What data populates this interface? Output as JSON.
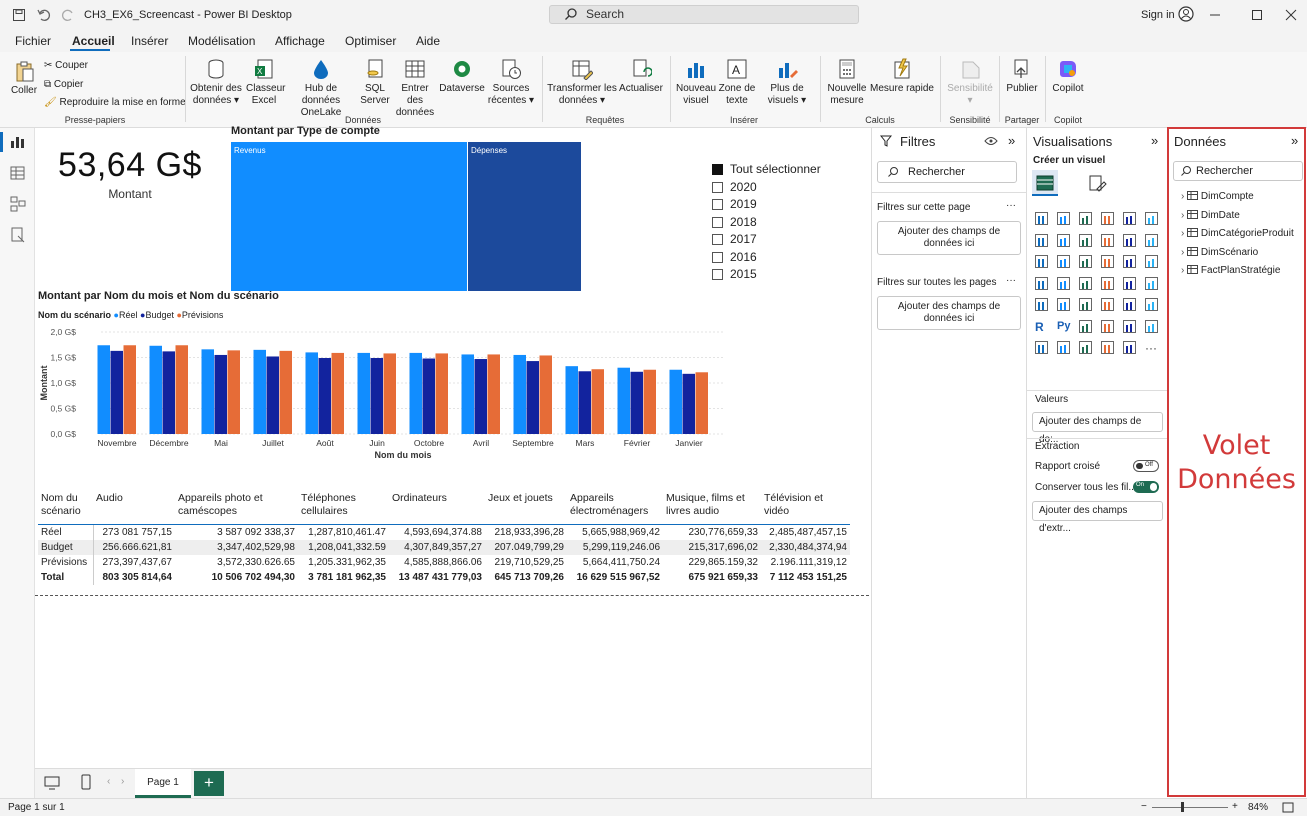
{
  "window": {
    "title": "CH3_EX6_Screencast - Power BI Desktop",
    "search": "Search",
    "signin": "Sign in"
  },
  "menu": [
    "Fichier",
    "Accueil",
    "Insérer",
    "Modélisation",
    "Affichage",
    "Optimiser",
    "Aide"
  ],
  "ribbon": {
    "coller": "Coller",
    "couper": "Couper",
    "copier": "Copier",
    "reproduire": "Reproduire la mise en forme",
    "grp_presse": "Presse-papiers",
    "obtenir": "Obtenir des",
    "obtenir2": "données",
    "classeur": "Classeur",
    "classeur2": "Excel",
    "hub": "Hub de données",
    "hub2": "OneLake",
    "sql": "SQL",
    "sql2": "Server",
    "entrer": "Entrer des",
    "entrer2": "données",
    "dataverse": "Dataverse",
    "sources": "Sources",
    "sources2": "récentes",
    "grp_donnees": "Données",
    "transformer": "Transformer les",
    "transformer2": "données",
    "actualiser": "Actualiser",
    "grp_requetes": "Requêtes",
    "nouveau": "Nouveau",
    "nouveau2": "visuel",
    "zone": "Zone de",
    "zone2": "texte",
    "plus": "Plus de",
    "plus2": "visuels",
    "grp_inserer": "Insérer",
    "mesure": "Nouvelle",
    "mesure2": "mesure",
    "rapide": "Mesure rapide",
    "grp_calculs": "Calculs",
    "sensibilite": "Sensibilité",
    "grp_sens": "Sensibilité",
    "publier": "Publier",
    "grp_partager": "Partager",
    "copilot": "Copilot",
    "grp_copilot": "Copilot"
  },
  "card": {
    "value": "53,64 G$",
    "label": "Montant"
  },
  "treemap": {
    "title": "Montant par Type de compte",
    "a": "Revenus",
    "b": "Dépenses"
  },
  "slicer": {
    "all": "Tout sélectionner",
    "years": [
      "2020",
      "2019",
      "2018",
      "2017",
      "2016",
      "2015"
    ]
  },
  "chart_data": {
    "type": "bar",
    "title": "Montant par Nom du mois et Nom du scénario",
    "legend_title": "Nom du scénario",
    "xlabel": "Nom du mois",
    "ylabel": "Montant",
    "ylim": [
      0,
      2.0
    ],
    "yticks": [
      "0,0 G$",
      "0,5 G$",
      "1,0 G$",
      "1,5 G$",
      "2,0 G$"
    ],
    "categories": [
      "Novembre",
      "Décembre",
      "Mai",
      "Juillet",
      "Août",
      "Juin",
      "Octobre",
      "Avril",
      "Septembre",
      "Mars",
      "Février",
      "Janvier"
    ],
    "series": [
      {
        "name": "Réel",
        "color": "#118dff",
        "values": [
          1.74,
          1.73,
          1.66,
          1.65,
          1.6,
          1.59,
          1.59,
          1.56,
          1.55,
          1.33,
          1.3,
          1.26
        ]
      },
      {
        "name": "Budget",
        "color": "#12239e",
        "values": [
          1.63,
          1.62,
          1.55,
          1.52,
          1.49,
          1.49,
          1.48,
          1.47,
          1.43,
          1.23,
          1.22,
          1.18
        ]
      },
      {
        "name": "Prévisions",
        "color": "#e66c37",
        "values": [
          1.74,
          1.74,
          1.64,
          1.63,
          1.59,
          1.58,
          1.58,
          1.56,
          1.54,
          1.27,
          1.26,
          1.21
        ]
      }
    ]
  },
  "matrix": {
    "headers": [
      "Nom du scénario",
      "Audio",
      "Appareils photo et caméscopes",
      "Téléphones cellulaires",
      "Ordinateurs",
      "Jeux et jouets",
      "Appareils électroménagers",
      "Musique, films et livres audio",
      "Télévision et vidéo"
    ],
    "rows": [
      [
        "Réel",
        "273 081 757,15",
        "3 587 092 338,37",
        "1,287,810,461.47",
        "4,593,694,374.88",
        "218,933,396,28",
        "5,665,988,969,42",
        "230,776,659,33",
        "2,485,487,457,15"
      ],
      [
        "Budget",
        "256.666.621,81",
        "3,347,402,529,98",
        "1,208,041,332.59",
        "4,307,849,357,27",
        "207.049,799,29",
        "5,299,119,246.06",
        "215,317,696,02",
        "2,330,484,374,94"
      ],
      [
        "Prévisions",
        "273,397,437,67",
        "3,572,330.626.65",
        "1,205.331,962,35",
        "4,585,888,866.06",
        "219,710,529,25",
        "5,664,411,750.24",
        "229,865.159,32",
        "2.196.111,319,12"
      ]
    ],
    "total": [
      "Total",
      "803 305 814,64",
      "10 506 702 494,30",
      "3 781 181 962,35",
      "13 487 431 779,03",
      "645 713 709,26",
      "16 629 515 967,52",
      "675 921 659,33",
      "7 112 453 151,25"
    ]
  },
  "filters": {
    "title": "Filtres",
    "search": "Rechercher",
    "page": "Filtres sur cette page",
    "add": "Ajouter des champs de données ici",
    "all": "Filtres sur toutes les pages",
    "add2": "Ajouter des champs de données ici"
  },
  "visu": {
    "title": "Visualisations",
    "create": "Créer un visuel",
    "more": "···",
    "valeurs": "Valeurs",
    "add_values": "Ajouter des champs de do:..",
    "extraction": "Extraction",
    "rapport": "Rapport croisé",
    "rapport_state": "Off",
    "conserver": "Conserver tous les fil...",
    "conserver_state": "On",
    "add_extract": "Ajouter des champs d'extr..."
  },
  "data": {
    "title": "Données",
    "search": "Rechercher",
    "tables": [
      "DimCompte",
      "DimDate",
      "DimCatégorieProduit",
      "DimScénario",
      "FactPlanStratégie"
    ],
    "annotation_line1": "Volet",
    "annotation_line2": "Données"
  },
  "pages": {
    "tab": "Page 1",
    "add": "+"
  },
  "status": {
    "page": "Page 1 sur 1",
    "zoom": "84%",
    "minus": "−",
    "plus": "+"
  }
}
